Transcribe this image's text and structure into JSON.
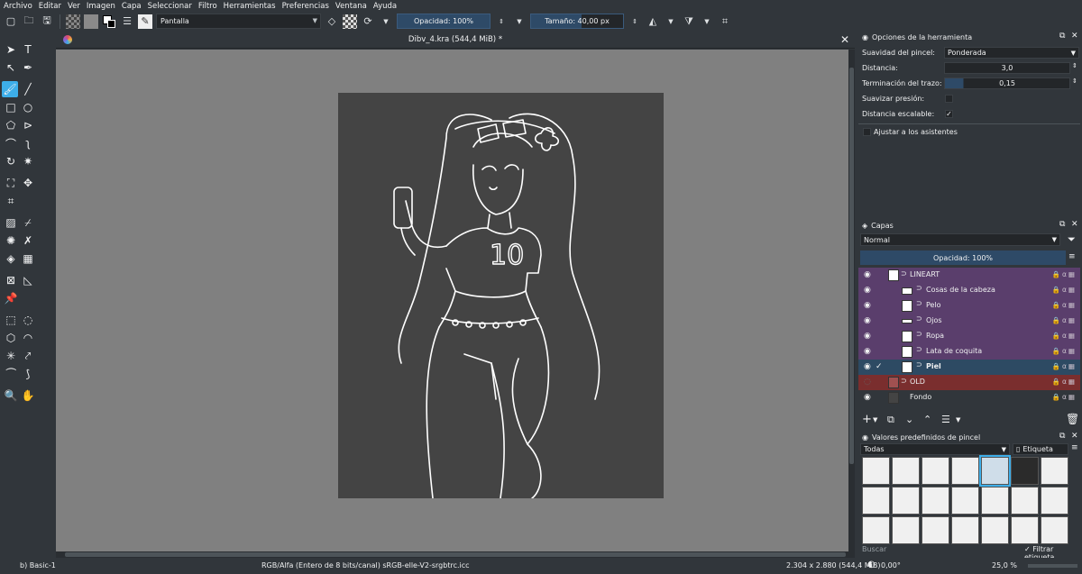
{
  "menu": [
    "Archivo",
    "Editar",
    "Ver",
    "Imagen",
    "Capa",
    "Seleccionar",
    "Filtro",
    "Herramientas",
    "Preferencias",
    "Ventana",
    "Ayuda"
  ],
  "toolbar": {
    "blend_mode": "Pantalla",
    "opacity": "Opacidad: 100%",
    "size": "Tamaño: 40,00 px"
  },
  "document": {
    "title": "Dibv_4.kra (544,4 MiB) *"
  },
  "tool_options": {
    "title": "Opciones de la herramienta",
    "smoothing_label": "Suavidad del pincel:",
    "smoothing_value": "Ponderada",
    "distance_label": "Distancia:",
    "distance_value": "3,0",
    "stroke_end_label": "Terminación del trazo:",
    "stroke_end_value": "0,15",
    "smooth_pressure_label": "Suavizar presión:",
    "scalable_distance_label": "Distancia escalable:",
    "snap_assistants_label": "Ajustar a los asistentes"
  },
  "layers": {
    "title": "Capas",
    "blend_mode": "Normal",
    "opacity": "Opacidad:  100%",
    "items": [
      {
        "name": "LINEART",
        "style": "purple"
      },
      {
        "name": "Cosas de la cabeza",
        "style": "purple"
      },
      {
        "name": "Pelo",
        "style": "purple"
      },
      {
        "name": "Ojos",
        "style": "purple"
      },
      {
        "name": "Ropa",
        "style": "purple"
      },
      {
        "name": "Lata de coquita",
        "style": "purple"
      },
      {
        "name": "Piel",
        "style": "selected"
      },
      {
        "name": "OLD",
        "style": "red"
      },
      {
        "name": "Fondo",
        "style": "dark"
      }
    ]
  },
  "brush_presets": {
    "title": "Valores predefinidos de pincel",
    "filter": "Todas",
    "tag_button": "Etiqueta",
    "search_placeholder": "Buscar",
    "filter_tag_label": "Filtrar etiqueta"
  },
  "status": {
    "preset": "b) Basic-1",
    "color_info": "RGB/Alfa (Entero de 8 bits/canal)  sRGB-elle-V2-srgbtrc.icc",
    "dimensions": "2.304 x 2.880 (544,4 MiB)",
    "rotation": "0,00°",
    "zoom": "25,0 %"
  },
  "colors": {
    "accent": "#3daee9",
    "panel_bg": "#31363b",
    "canvas_bg": "#444444",
    "layer_purple": "#5a3e6c",
    "layer_selected": "#2d4a63",
    "layer_red": "#7a2e2e"
  }
}
